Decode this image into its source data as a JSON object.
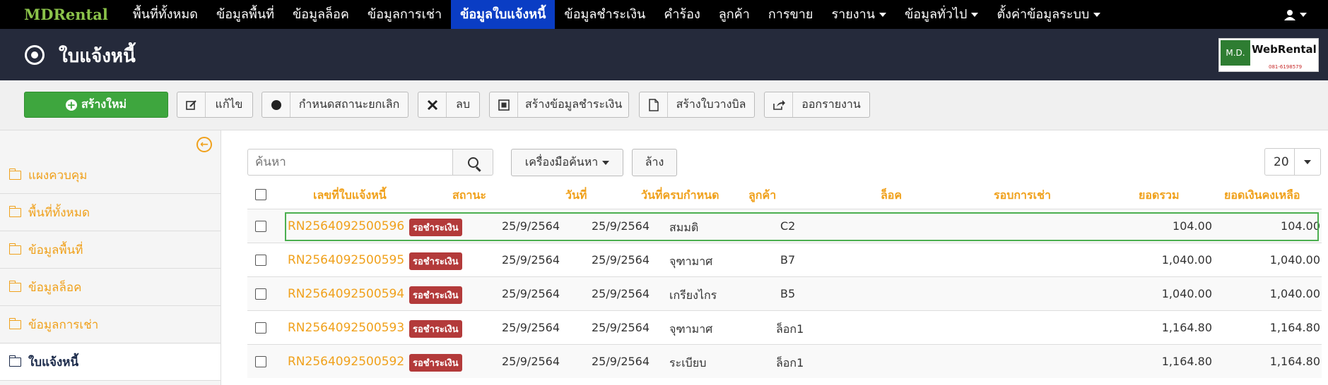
{
  "navbar": {
    "brand": "MDRental",
    "items": [
      {
        "label": "พื้นที่ทั้งหมด",
        "dropdown": false
      },
      {
        "label": "ข้อมูลพื้นที่",
        "dropdown": false
      },
      {
        "label": "ข้อมูลล็อค",
        "dropdown": false
      },
      {
        "label": "ข้อมูลการเช่า",
        "dropdown": false
      },
      {
        "label": "ข้อมูลใบแจ้งหนี้",
        "dropdown": false,
        "active": true
      },
      {
        "label": "ข้อมูลชำระเงิน",
        "dropdown": false
      },
      {
        "label": "คำร้อง",
        "dropdown": false
      },
      {
        "label": "ลูกค้า",
        "dropdown": false
      },
      {
        "label": "การขาย",
        "dropdown": false
      },
      {
        "label": "รายงาน",
        "dropdown": true
      },
      {
        "label": "ข้อมูลทั่วไป",
        "dropdown": true
      },
      {
        "label": "ตั้งค่าข้อมูลระบบ",
        "dropdown": true
      }
    ],
    "user_icon": "user-icon"
  },
  "header": {
    "title": "ใบแจ้งหนี้",
    "logo": {
      "left": "M.D.",
      "right": "WebRental",
      "phone": "081-6198579"
    }
  },
  "toolbar": {
    "create": "สร้างใหม่",
    "edit": "แก้ไข",
    "cancel_status": "กำหนดสถานะยกเลิก",
    "delete": "ลบ",
    "create_payment": "สร้างข้อมูลชำระเงิน",
    "create_billing": "สร้างใบวางบิล",
    "export": "ออกรายงาน"
  },
  "sidebar": {
    "items": [
      {
        "label": "แผงควบคุม"
      },
      {
        "label": "พื้นที่ทั้งหมด"
      },
      {
        "label": "ข้อมูลพื้นที่"
      },
      {
        "label": "ข้อมูลล็อค"
      },
      {
        "label": "ข้อมูลการเช่า"
      },
      {
        "label": "ใบแจ้งหนี้",
        "active": true
      }
    ]
  },
  "search": {
    "placeholder": "ค้นหา",
    "tools": "เครื่องมือค้นหา",
    "clear": "ล้าง",
    "page_size": "20"
  },
  "table": {
    "columns": {
      "invoice_no": "เลขที่ใบแจ้งหนี้",
      "status": "สถานะ",
      "date": "วันที่",
      "due_date": "วันที่ครบกำหนด",
      "customer": "ลูกค้า",
      "lock": "ล็อค",
      "rental_period": "รอบการเช่า",
      "total": "ยอดรวม",
      "balance": "ยอดเงินคงเหลือ"
    },
    "rows": [
      {
        "invoice_no": "RN2564092500596",
        "status": "รอชำระเงิน",
        "date": "25/9/2564",
        "due_date": "25/9/2564",
        "customer": "สมมติ",
        "lock": "C2",
        "rental_period": "",
        "total": "104.00",
        "balance": "104.00"
      },
      {
        "invoice_no": "RN2564092500595",
        "status": "รอชำระเงิน",
        "date": "25/9/2564",
        "due_date": "25/9/2564",
        "customer": "จุฑามาศ",
        "lock": "B7",
        "rental_period": "",
        "total": "1,040.00",
        "balance": "1,040.00"
      },
      {
        "invoice_no": "RN2564092500594",
        "status": "รอชำระเงิน",
        "date": "25/9/2564",
        "due_date": "25/9/2564",
        "customer": "เกรียงไกร",
        "lock": "B5",
        "rental_period": "",
        "total": "1,040.00",
        "balance": "1,040.00"
      },
      {
        "invoice_no": "RN2564092500593",
        "status": "รอชำระเงิน",
        "date": "25/9/2564",
        "due_date": "25/9/2564",
        "customer": "จุฑามาศ",
        "lock": "ล็อก1",
        "rental_period": "",
        "total": "1,164.80",
        "balance": "1,164.80"
      },
      {
        "invoice_no": "RN2564092500592",
        "status": "รอชำระเงิน",
        "date": "25/9/2564",
        "due_date": "25/9/2564",
        "customer": "ระเบียบ",
        "lock": "ล็อก1",
        "rental_period": "",
        "total": "1,164.80",
        "balance": "1,164.80"
      }
    ]
  },
  "colors": {
    "accent": "#f0a11c",
    "nav_active": "#0a3dc4",
    "header_bg": "#252a3b",
    "create_green": "#3ea63e",
    "status_badge": "#b33a3a",
    "selected_border": "#4caf50"
  }
}
